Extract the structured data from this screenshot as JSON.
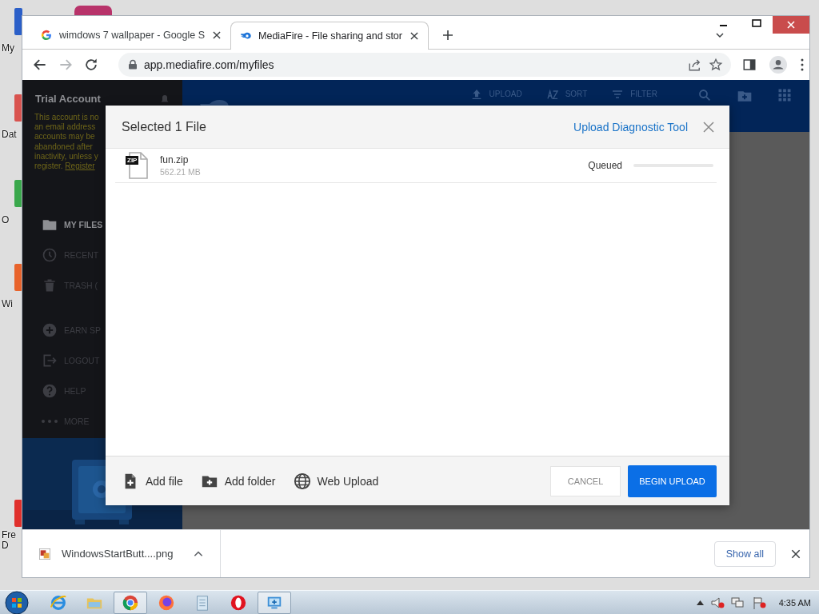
{
  "desktop": {
    "icons": [
      {
        "label": "My",
        "kind": "computer"
      },
      {
        "label": "Dat",
        "kind": "tool"
      },
      {
        "label": "O",
        "kind": "green"
      },
      {
        "label": "Wi",
        "kind": "orange"
      },
      {
        "label": "Fre D",
        "kind": "red"
      }
    ]
  },
  "browser": {
    "tabs": [
      {
        "title": "wimdows 7 wallpaper - Google S",
        "kind": "google",
        "selected": false
      },
      {
        "title": "MediaFire - File sharing and stor",
        "kind": "mediafire",
        "selected": true
      }
    ],
    "forward_disabled": true,
    "url": "app.mediafire.com/myfiles"
  },
  "sidebar": {
    "account_title": "Trial Account",
    "warning_lines": [
      "This account is no",
      "an email address",
      "accounts may be",
      "abandoned after",
      "inactivity, unless y",
      "register."
    ],
    "register_link": "Register",
    "items": [
      {
        "label": "MY FILES",
        "kind": "folder",
        "selected": true
      },
      {
        "label": "RECENT",
        "kind": "clock",
        "selected": false
      },
      {
        "label": "TRASH (",
        "kind": "trash",
        "selected": false
      },
      {
        "label": "EARN SP",
        "kind": "plus",
        "selected": false
      },
      {
        "label": "LOGOUT",
        "kind": "logout",
        "selected": false
      },
      {
        "label": "HELP",
        "kind": "help",
        "selected": false
      },
      {
        "label": "MORE",
        "kind": "more",
        "selected": false
      }
    ]
  },
  "toolbar": {
    "items": [
      {
        "label": "UPLOAD",
        "kind": "upload"
      },
      {
        "label": "SORT",
        "kind": "sort"
      },
      {
        "label": "FILTER",
        "kind": "filter"
      }
    ]
  },
  "dialog": {
    "title": "Selected 1 File",
    "diagnostic_link": "Upload Diagnostic Tool",
    "files": [
      {
        "badge": "ZIP",
        "name": "fun.zip",
        "size": "562.21 MB",
        "status": "Queued",
        "level": 0
      }
    ],
    "actions": [
      {
        "label": "Add file",
        "kind": "add-file"
      },
      {
        "label": "Add folder",
        "kind": "add-folder"
      },
      {
        "label": "Web Upload",
        "kind": "globe"
      }
    ],
    "cancel": "CANCEL",
    "begin": "BEGIN UPLOAD"
  },
  "downloads": {
    "file": "WindowsStartButt....png",
    "show_all": "Show all"
  },
  "taskbar": {
    "apps": [
      {
        "kind": "ie",
        "selected": false
      },
      {
        "kind": "explorer",
        "selected": false
      },
      {
        "kind": "chrome",
        "selected": true
      },
      {
        "kind": "firefox",
        "selected": false
      },
      {
        "kind": "notepad",
        "selected": false
      },
      {
        "kind": "opera",
        "selected": false
      },
      {
        "kind": "remote",
        "selected": true
      }
    ],
    "clock": "4:35 AM"
  }
}
